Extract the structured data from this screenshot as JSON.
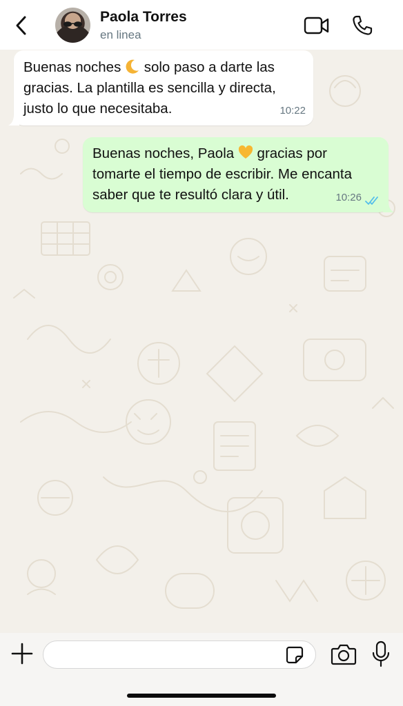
{
  "header": {
    "contact_name": "Paola Torres",
    "status": "en linea"
  },
  "messages": [
    {
      "direction": "incoming",
      "text_before": "Buenas noches ",
      "emoji": "crescent-moon",
      "text_after": " solo paso a darte las gracias. La plantilla es sencilla y directa, justo lo que necesitaba.",
      "time": "10:22"
    },
    {
      "direction": "outgoing",
      "text_before": "Buenas noches, Paola ",
      "emoji": "yellow-heart",
      "text_after": " gracias por tomarte el tiempo de escribir. Me encanta saber que te resultó clara y útil.",
      "time": "10:26",
      "status": "read"
    }
  ],
  "composer": {
    "value": "",
    "placeholder": ""
  },
  "colors": {
    "incoming_bubble": "#ffffff",
    "outgoing_bubble": "#d9fdd3",
    "read_ticks": "#53bdeb",
    "chat_background": "#f3f0ea"
  },
  "icons": {
    "back": "chevron-left-icon",
    "video": "video-camera-icon",
    "call": "phone-icon",
    "attach": "plus-icon",
    "sticker": "sticker-icon",
    "camera": "camera-icon",
    "mic": "microphone-icon"
  }
}
